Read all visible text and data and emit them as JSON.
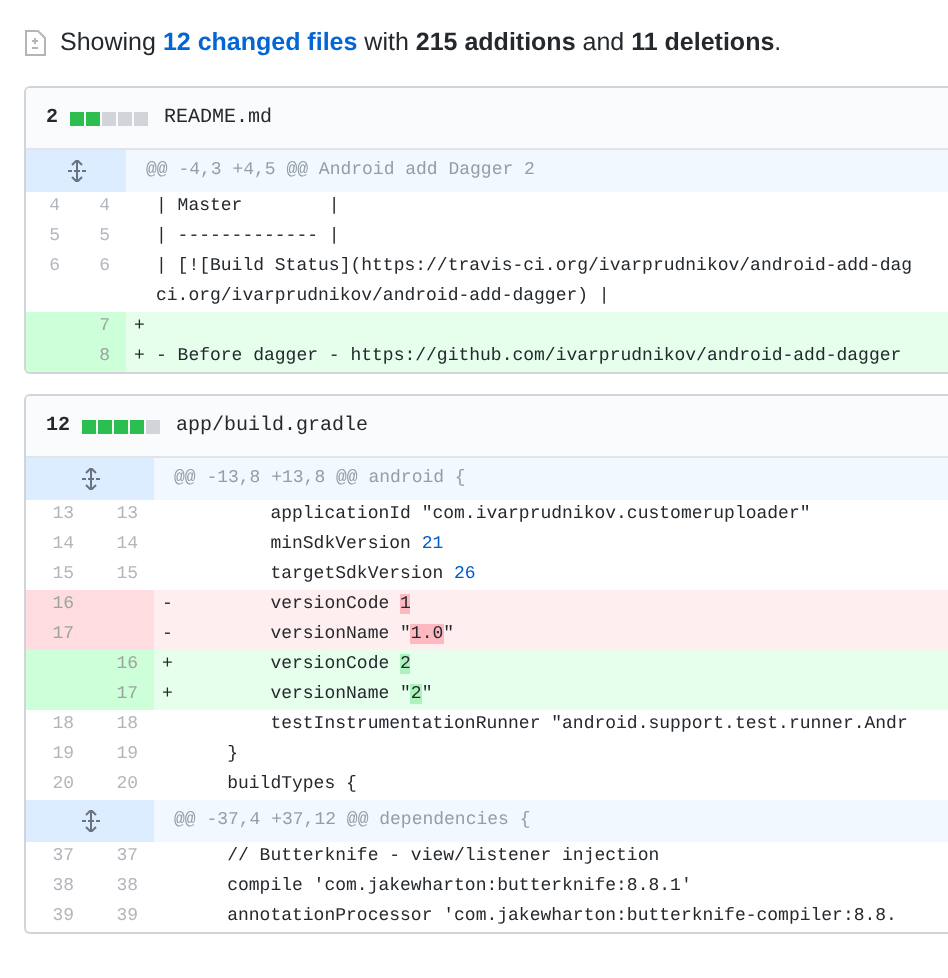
{
  "summary": {
    "prefix": "Showing ",
    "link": "12 changed files",
    "rest": " with **215 additions** and **11 deletions**."
  },
  "files": [
    {
      "count": "2",
      "stat": [
        {
          "kind": "added"
        },
        {
          "kind": "added"
        },
        {
          "kind": "neutral"
        },
        {
          "kind": "neutral"
        },
        {
          "kind": "neutral"
        }
      ],
      "path": "README.md",
      "rows": [
        {
          "kind": "hunk",
          "text": "@@ -4,3 +4,5 @@ Android add Dagger 2"
        },
        {
          "kind": "context",
          "old": "4",
          "new": "4",
          "parts": [
            {
              "t": "| Master        |"
            }
          ]
        },
        {
          "kind": "context",
          "old": "5",
          "new": "5",
          "parts": [
            {
              "t": "| ------------- |"
            }
          ]
        },
        {
          "kind": "context",
          "old": "6",
          "new": "6",
          "parts": [
            {
              "t": "| [![Build Status](https://travis-ci.org/ivarprudnikov/android-add-dag"
            }
          ],
          "wrap": "ci.org/ivarprudnikov/android-add-dagger) |"
        },
        {
          "kind": "addition",
          "new": "7",
          "marker": "+"
        },
        {
          "kind": "addition",
          "new": "8",
          "marker": "+",
          "parts": [
            {
              "t": "- Before dagger - https://github.com/ivarprudnikov/android-add-dagger"
            }
          ]
        }
      ]
    },
    {
      "count": "12",
      "stat": [
        {
          "kind": "added"
        },
        {
          "kind": "added"
        },
        {
          "kind": "added"
        },
        {
          "kind": "added"
        },
        {
          "kind": "neutral"
        }
      ],
      "path": "app/build.gradle",
      "rows": [
        {
          "kind": "hunk",
          "text": "@@ -13,8 +13,8 @@ android {"
        },
        {
          "kind": "context",
          "old": "13",
          "new": "13",
          "parts": [
            {
              "t": "        applicationId \"com.ivarprudnikov.customeruploader\""
            }
          ]
        },
        {
          "kind": "context",
          "old": "14",
          "new": "14",
          "parts": [
            {
              "t": "        minSdkVersion "
            },
            {
              "t": "21",
              "kind": "number"
            }
          ]
        },
        {
          "kind": "context",
          "old": "15",
          "new": "15",
          "parts": [
            {
              "t": "        targetSdkVersion "
            },
            {
              "t": "26",
              "kind": "number"
            }
          ]
        },
        {
          "kind": "deletion",
          "old": "16",
          "marker": "-",
          "parts": [
            {
              "t": "        versionCode "
            },
            {
              "t": "1",
              "kind": "changed"
            }
          ]
        },
        {
          "kind": "deletion",
          "old": "17",
          "marker": "-",
          "parts": [
            {
              "t": "        versionName \""
            },
            {
              "t": "1.0",
              "kind": "changed"
            },
            {
              "t": "\""
            }
          ]
        },
        {
          "kind": "addition",
          "new": "16",
          "marker": "+",
          "parts": [
            {
              "t": "        versionCode "
            },
            {
              "t": "2",
              "kind": "changed"
            }
          ]
        },
        {
          "kind": "addition",
          "new": "17",
          "marker": "+",
          "parts": [
            {
              "t": "        versionName \""
            },
            {
              "t": "2",
              "kind": "changed"
            },
            {
              "t": "\""
            }
          ]
        },
        {
          "kind": "context",
          "old": "18",
          "new": "18",
          "parts": [
            {
              "t": "        testInstrumentationRunner \"android.support.test.runner.Andr"
            }
          ]
        },
        {
          "kind": "context",
          "old": "19",
          "new": "19",
          "parts": [
            {
              "t": "    }"
            }
          ]
        },
        {
          "kind": "context",
          "old": "20",
          "new": "20",
          "parts": [
            {
              "t": "    buildTypes {"
            }
          ]
        },
        {
          "kind": "hunk",
          "text": "@@ -37,4 +37,12 @@ dependencies {"
        },
        {
          "kind": "context",
          "old": "37",
          "new": "37",
          "parts": [
            {
              "t": "    // Butterknife - view/listener injection"
            }
          ]
        },
        {
          "kind": "context",
          "old": "38",
          "new": "38",
          "parts": [
            {
              "t": "    compile 'com.jakewharton:butterknife:8.8.1'"
            }
          ]
        },
        {
          "kind": "context",
          "old": "39",
          "new": "39",
          "parts": [
            {
              "t": "    annotationProcessor 'com.jakewharton:butterknife-compiler:8.8."
            }
          ]
        }
      ]
    }
  ]
}
